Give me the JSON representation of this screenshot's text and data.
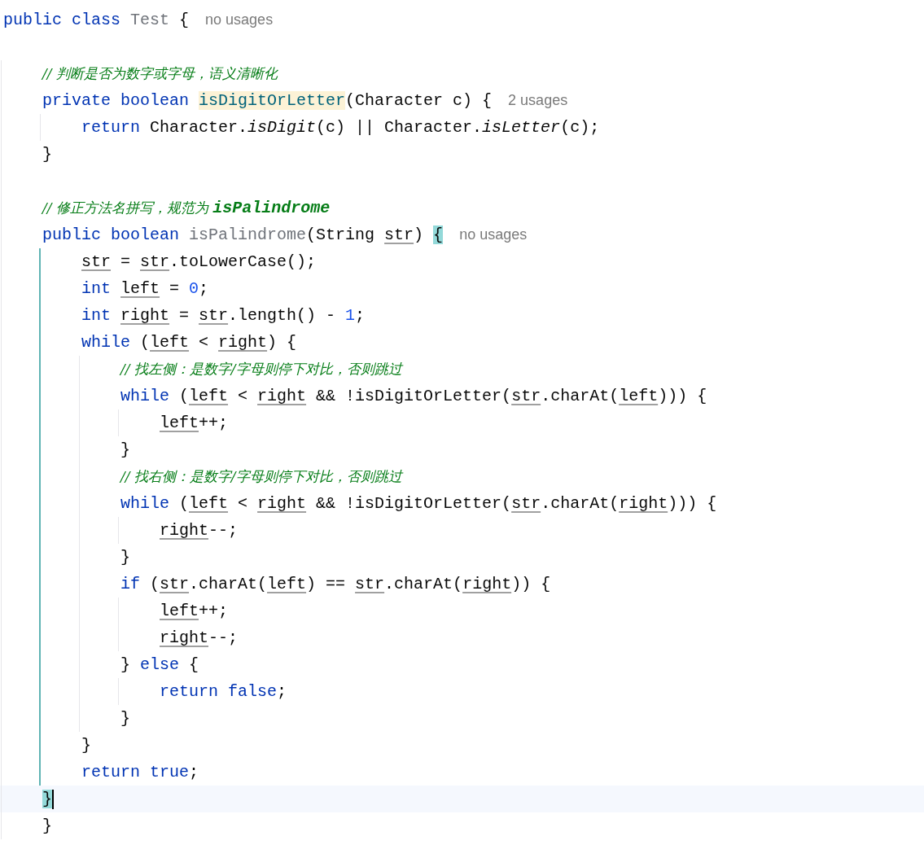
{
  "lines": [
    {
      "tokens": [
        {
          "kind": "keyword",
          "text": "public class "
        },
        {
          "kind": "unused",
          "text": "Test"
        },
        {
          "kind": "plain",
          "text": " {"
        }
      ],
      "hint": "no usages",
      "children": [
        {
          "tokens": [
            {
              "kind": "comment",
              "text": "// 判断是否为数字或字母，语义清晰化"
            }
          ]
        },
        {
          "tokens": [
            {
              "kind": "keyword",
              "text": "private boolean "
            },
            {
              "kind": "decl",
              "text": "isDigitOrLetter",
              "highlighted": true
            },
            {
              "kind": "plain",
              "text": "(Character c) {"
            }
          ],
          "hint": "2 usages",
          "active": false,
          "children": [
            {
              "tokens": [
                {
                  "kind": "keyword",
                  "text": "return"
                },
                {
                  "kind": "plain",
                  "text": " Character."
                },
                {
                  "kind": "static",
                  "text": "isDigit"
                },
                {
                  "kind": "plain",
                  "text": "(c) || Character."
                },
                {
                  "kind": "static",
                  "text": "isLetter"
                },
                {
                  "kind": "plain",
                  "text": "(c);"
                }
              ]
            }
          ]
        },
        {
          "tokens": [
            {
              "kind": "plain",
              "text": "}"
            }
          ]
        },
        {
          "tokens": [
            {
              "kind": "comment",
              "text": "// 修正方法名拼写，规范为 "
            },
            {
              "kind": "comment_code",
              "text": "isPalindrome"
            }
          ]
        },
        {
          "tokens": [
            {
              "kind": "keyword",
              "text": "public boolean "
            },
            {
              "kind": "unused",
              "text": "isPalindrome"
            },
            {
              "kind": "plain",
              "text": "(String "
            },
            {
              "kind": "var",
              "text": "str"
            },
            {
              "kind": "plain",
              "text": ") "
            },
            {
              "kind": "plain",
              "text": "{",
              "highlighted": true
            }
          ],
          "hint": "no usages",
          "active": true,
          "children": [
            {
              "tokens": [
                {
                  "kind": "var",
                  "text": "str"
                },
                {
                  "kind": "plain",
                  "text": " = "
                },
                {
                  "kind": "var",
                  "text": "str"
                },
                {
                  "kind": "plain",
                  "text": ".toLowerCase();"
                }
              ]
            },
            {
              "tokens": [
                {
                  "kind": "keyword",
                  "text": "int "
                },
                {
                  "kind": "var",
                  "text": "left"
                },
                {
                  "kind": "plain",
                  "text": " = "
                },
                {
                  "kind": "number",
                  "text": "0"
                },
                {
                  "kind": "plain",
                  "text": ";"
                }
              ]
            },
            {
              "tokens": [
                {
                  "kind": "keyword",
                  "text": "int "
                },
                {
                  "kind": "var",
                  "text": "right"
                },
                {
                  "kind": "plain",
                  "text": " = "
                },
                {
                  "kind": "var",
                  "text": "str"
                },
                {
                  "kind": "plain",
                  "text": ".length() - "
                },
                {
                  "kind": "number",
                  "text": "1"
                },
                {
                  "kind": "plain",
                  "text": ";"
                }
              ]
            },
            {
              "tokens": [
                {
                  "kind": "keyword",
                  "text": "while"
                },
                {
                  "kind": "plain",
                  "text": " ("
                },
                {
                  "kind": "var",
                  "text": "left"
                },
                {
                  "kind": "plain",
                  "text": " < "
                },
                {
                  "kind": "var",
                  "text": "right"
                },
                {
                  "kind": "plain",
                  "text": ") {"
                }
              ],
              "active": false,
              "children": [
                {
                  "tokens": [
                    {
                      "kind": "comment",
                      "text": "// 找左侧：是数字/字母则停下对比，否则跳过"
                    }
                  ]
                },
                {
                  "tokens": [
                    {
                      "kind": "keyword",
                      "text": "while"
                    },
                    {
                      "kind": "plain",
                      "text": " ("
                    },
                    {
                      "kind": "var",
                      "text": "left"
                    },
                    {
                      "kind": "plain",
                      "text": " < "
                    },
                    {
                      "kind": "var",
                      "text": "right"
                    },
                    {
                      "kind": "plain",
                      "text": " && !isDigitOrLetter("
                    },
                    {
                      "kind": "var",
                      "text": "str"
                    },
                    {
                      "kind": "plain",
                      "text": ".charAt("
                    },
                    {
                      "kind": "var",
                      "text": "left"
                    },
                    {
                      "kind": "plain",
                      "text": "))) {"
                    }
                  ],
                  "active": false,
                  "children": [
                    {
                      "tokens": [
                        {
                          "kind": "var",
                          "text": "left"
                        },
                        {
                          "kind": "plain",
                          "text": "++;"
                        }
                      ]
                    }
                  ]
                },
                {
                  "tokens": [
                    {
                      "kind": "plain",
                      "text": "}"
                    }
                  ]
                },
                {
                  "tokens": [
                    {
                      "kind": "comment",
                      "text": "// 找右侧：是数字/字母则停下对比，否则跳过"
                    }
                  ]
                },
                {
                  "tokens": [
                    {
                      "kind": "keyword",
                      "text": "while"
                    },
                    {
                      "kind": "plain",
                      "text": " ("
                    },
                    {
                      "kind": "var",
                      "text": "left"
                    },
                    {
                      "kind": "plain",
                      "text": " < "
                    },
                    {
                      "kind": "var",
                      "text": "right"
                    },
                    {
                      "kind": "plain",
                      "text": " && !isDigitOrLetter("
                    },
                    {
                      "kind": "var",
                      "text": "str"
                    },
                    {
                      "kind": "plain",
                      "text": ".charAt("
                    },
                    {
                      "kind": "var",
                      "text": "right"
                    },
                    {
                      "kind": "plain",
                      "text": "))) {"
                    }
                  ],
                  "active": false,
                  "children": [
                    {
                      "tokens": [
                        {
                          "kind": "var",
                          "text": "right"
                        },
                        {
                          "kind": "plain",
                          "text": "--;"
                        }
                      ]
                    }
                  ]
                },
                {
                  "tokens": [
                    {
                      "kind": "plain",
                      "text": "}"
                    }
                  ]
                },
                {
                  "tokens": [
                    {
                      "kind": "keyword",
                      "text": "if"
                    },
                    {
                      "kind": "plain",
                      "text": " ("
                    },
                    {
                      "kind": "var",
                      "text": "str"
                    },
                    {
                      "kind": "plain",
                      "text": ".charAt("
                    },
                    {
                      "kind": "var",
                      "text": "left"
                    },
                    {
                      "kind": "plain",
                      "text": ") == "
                    },
                    {
                      "kind": "var",
                      "text": "str"
                    },
                    {
                      "kind": "plain",
                      "text": ".charAt("
                    },
                    {
                      "kind": "var",
                      "text": "right"
                    },
                    {
                      "kind": "plain",
                      "text": ")) {"
                    }
                  ],
                  "active": false,
                  "children": [
                    {
                      "tokens": [
                        {
                          "kind": "var",
                          "text": "left"
                        },
                        {
                          "kind": "plain",
                          "text": "++;"
                        }
                      ]
                    },
                    {
                      "tokens": [
                        {
                          "kind": "var",
                          "text": "right"
                        },
                        {
                          "kind": "plain",
                          "text": "--;"
                        }
                      ]
                    }
                  ]
                },
                {
                  "tokens": [
                    {
                      "kind": "plain",
                      "text": "} "
                    },
                    {
                      "kind": "keyword",
                      "text": "else"
                    },
                    {
                      "kind": "plain",
                      "text": " {"
                    }
                  ],
                  "active": false,
                  "children": [
                    {
                      "tokens": [
                        {
                          "kind": "keyword",
                          "text": "return false"
                        },
                        {
                          "kind": "plain",
                          "text": ";"
                        }
                      ]
                    }
                  ]
                },
                {
                  "tokens": [
                    {
                      "kind": "plain",
                      "text": "}"
                    }
                  ]
                }
              ]
            },
            {
              "tokens": [
                {
                  "kind": "plain",
                  "text": "}"
                }
              ]
            },
            {
              "tokens": [
                {
                  "kind": "keyword",
                  "text": "return true"
                },
                {
                  "kind": "plain",
                  "text": ";"
                }
              ]
            }
          ]
        },
        {
          "tokens": [
            {
              "kind": "plain",
              "text": "}",
              "highlighted": true
            }
          ],
          "current": true
        },
        {
          "tokens": [
            {
              "kind": "plain",
              "text": "}"
            }
          ],
          "current": false
        }
      ]
    }
  ]
}
